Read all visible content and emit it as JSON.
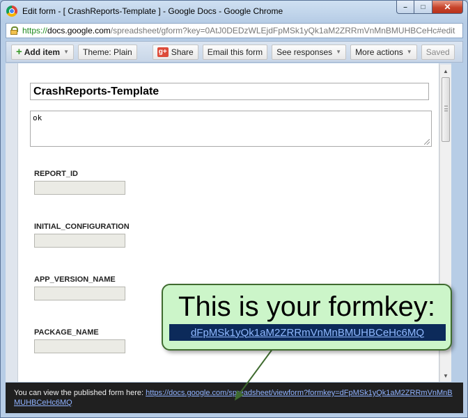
{
  "window": {
    "title": "Edit form - [ CrashReports-Template ] - Google Docs - Google Chrome",
    "controls": {
      "minimize": "–",
      "maximize": "□",
      "close": "✕"
    }
  },
  "address": {
    "scheme": "https://",
    "host": "docs.google.com",
    "path": "/spreadsheet/gform?key=0AtJ0DEDzWLEjdFpMSk1yQk1aM2ZRRmVnMnBMUHBCeHc#edit"
  },
  "toolbar": {
    "add_item": "Add item",
    "theme": "Theme:  Plain",
    "share": "Share",
    "share_icon_text": "g+",
    "email": "Email this form",
    "see_responses": "See responses",
    "more_actions": "More actions",
    "saved": "Saved",
    "dropdown_arrow": "▼"
  },
  "form": {
    "title": "CrashReports-Template",
    "description": "ok",
    "fields": [
      {
        "label": "REPORT_ID"
      },
      {
        "label": "INITIAL_CONFIGURATION"
      },
      {
        "label": "APP_VERSION_NAME"
      },
      {
        "label": "PACKAGE_NAME"
      }
    ]
  },
  "scrollbar": {
    "up": "▲",
    "down": "▼"
  },
  "bottombar": {
    "prefix": "You can view the published form here: ",
    "link": "https://docs.google.com/spreadsheet/viewform?formkey=dFpMSk1yQk1aM2ZRRmVnMnBMUHBCeHc6MQ"
  },
  "callout": {
    "heading": "This is your formkey:",
    "formkey": "dFpMSk1yQk1aM2ZRRmVnMnBMUHBCeHc6MQ"
  },
  "colors": {
    "callout_bg": "#ccf5c9",
    "callout_border": "#3f6b2f",
    "bottombar_bg": "#202020",
    "link": "#8fb2ff"
  }
}
